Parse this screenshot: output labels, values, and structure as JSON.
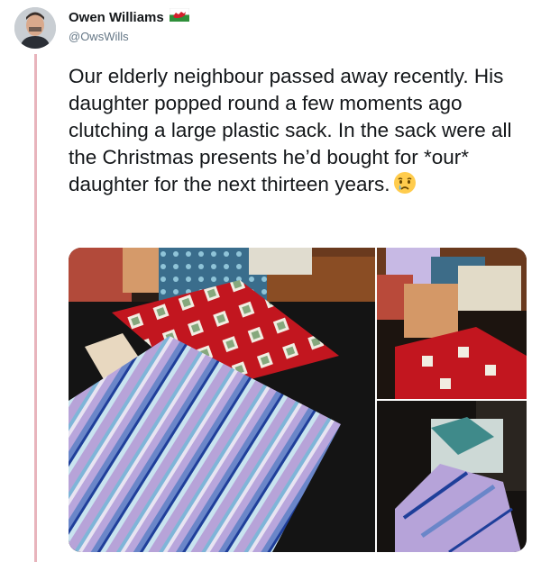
{
  "author": {
    "display_name": "Owen Williams",
    "handle": "@OwsWills",
    "flag_icon": "wales-flag-icon"
  },
  "tweet": {
    "text": "Our elderly neighbour passed away recently. His daughter popped round a few moments ago clutching a large plastic sack. In the sack were all the Christmas presents he’d bought for *our* daughter for the next thirteen years.",
    "emoji_icon": "crying-face-icon"
  },
  "media": {
    "photo_count": 3,
    "photos": [
      "main-photo",
      "top-right-photo",
      "bottom-right-photo"
    ]
  },
  "colors": {
    "thread_line": "#e8b4bc",
    "text": "#14171a",
    "secondary_text": "#657786"
  }
}
